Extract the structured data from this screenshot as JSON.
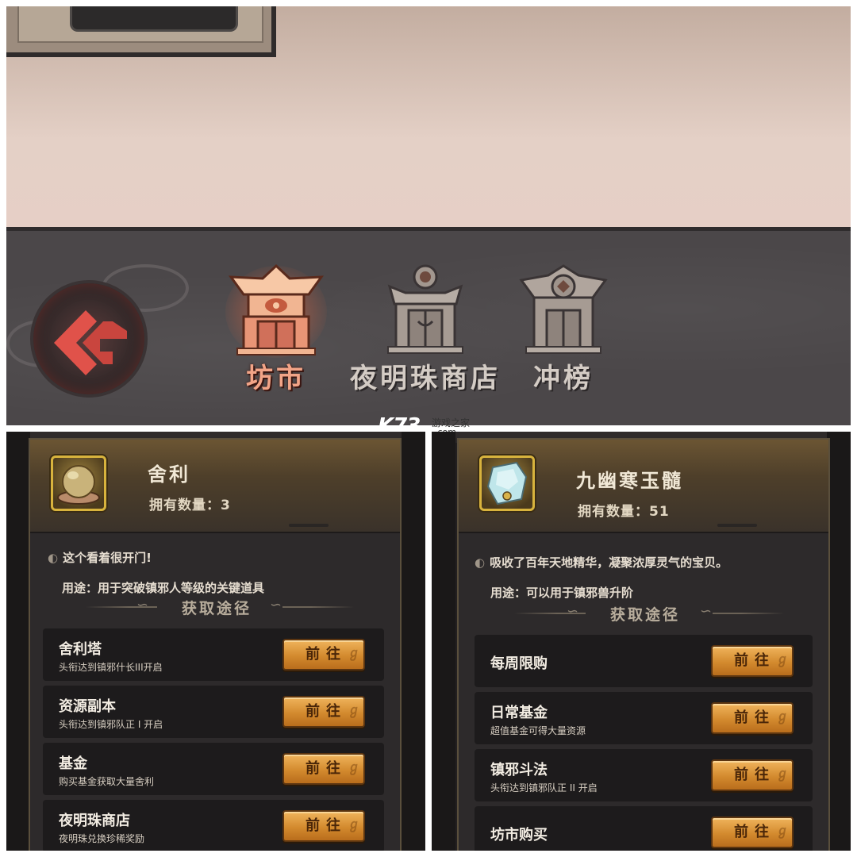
{
  "header": {
    "tabs": [
      {
        "label": "坊市",
        "state": "active",
        "icon": "market-building-icon"
      },
      {
        "label": "夜明珠商店",
        "state": "inactive",
        "icon": "pearl-shop-building-icon"
      },
      {
        "label": "冲榜",
        "state": "inactive",
        "icon": "ranking-building-icon"
      }
    ],
    "back_icon": "back-arrow-icon"
  },
  "watermark": {
    "logo": "K73",
    "cn": "游戏之家",
    "domain": ".com"
  },
  "left_popup": {
    "item_name": "舍利",
    "count_label": "拥有数量：3",
    "description": "这个看着很开门!",
    "usage": "用途：用于突破镇邪人等级的关键道具",
    "source_title": "获取途径",
    "sources": [
      {
        "title": "舍利塔",
        "subtitle": "头衔达到镇邪什长III开启",
        "button": "前往"
      },
      {
        "title": "资源副本",
        "subtitle": "头衔达到镇邪队正 I 开启",
        "button": "前往"
      },
      {
        "title": "基金",
        "subtitle": "购买基金获取大量舍利",
        "button": "前往"
      },
      {
        "title": "夜明珠商店",
        "subtitle": "夜明珠兑换珍稀奖励",
        "button": "前往"
      }
    ]
  },
  "right_popup": {
    "item_name": "九幽寒玉髓",
    "count_label": "拥有数量：51",
    "description": "吸收了百年天地精华，凝聚浓厚灵气的宝贝。",
    "usage": "用途：可以用于镇邪兽升阶",
    "source_title": "获取途径",
    "sources": [
      {
        "title": "每周限购",
        "subtitle": "",
        "button": "前往"
      },
      {
        "title": "日常基金",
        "subtitle": "超值基金可得大量资源",
        "button": "前往"
      },
      {
        "title": "镇邪斗法",
        "subtitle": "头衔达到镇邪队正 II 开启",
        "button": "前往"
      },
      {
        "title": "坊市购买",
        "subtitle": "",
        "button": "前往"
      }
    ]
  },
  "colors": {
    "active_tab": "#f2a487",
    "inactive_tab": "#d4ccc5",
    "button_gold": "#d38a2e",
    "icon_border": "#d8b33d"
  }
}
